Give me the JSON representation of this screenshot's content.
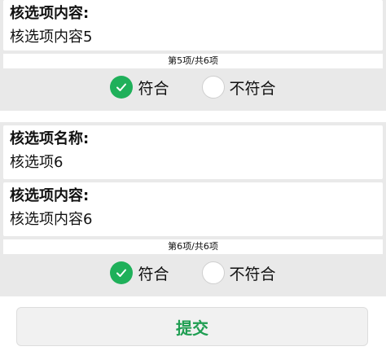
{
  "items": [
    {
      "content_label": "核选项内容:",
      "content_value": "核选项内容5",
      "counter": "第5项/共6项",
      "option_yes": "符合",
      "option_no": "不符合"
    },
    {
      "name_label": "核选项名称:",
      "name_value": "核选项6",
      "content_label": "核选项内容:",
      "content_value": "核选项内容6",
      "counter": "第6项/共6项",
      "option_yes": "符合",
      "option_no": "不符合"
    }
  ],
  "submit_label": "提交",
  "colors": {
    "accent": "#1fb05a",
    "submit_text": "#1f9e52",
    "group_bg": "#e9e9e9"
  },
  "icons": {
    "checked": "check-icon"
  }
}
